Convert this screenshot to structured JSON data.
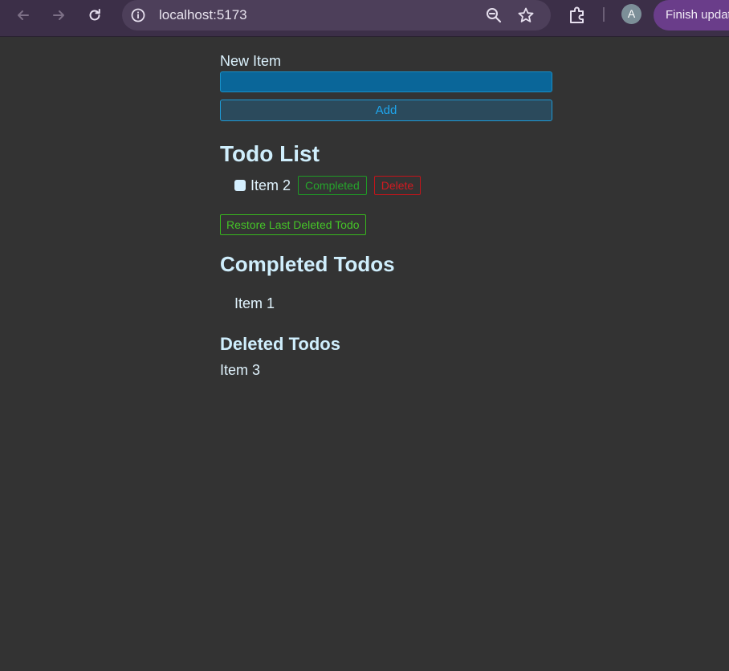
{
  "browser": {
    "url": "localhost:5173",
    "avatar_initial": "A",
    "update_label": "Finish update",
    "icons": {
      "back": "arrow-left-icon",
      "forward": "arrow-right-icon",
      "reload": "reload-icon",
      "info": "info-icon",
      "zoom": "zoom-out-icon",
      "bookmark": "star-icon",
      "extensions": "puzzle-icon"
    }
  },
  "form": {
    "label": "New Item",
    "input_value": "",
    "add_label": "Add"
  },
  "todo_list": {
    "heading": "Todo List",
    "items": [
      {
        "text": "Item 2",
        "checked": false,
        "completed_label": "Completed",
        "delete_label": "Delete"
      }
    ]
  },
  "restore_label": "Restore Last Deleted Todo",
  "completed": {
    "heading": "Completed Todos",
    "items": [
      "Item 1"
    ]
  },
  "deleted": {
    "heading": "Deleted Todos",
    "items": [
      "Item 3"
    ]
  },
  "colors": {
    "page_bg": "#333333",
    "input_bg": "#0a6699",
    "accent_blue": "#1ea6ee",
    "completed_green": "#26a52c",
    "delete_red": "#d11a20",
    "restore_green": "#45c428",
    "update_purple": "#6a3d8a"
  }
}
